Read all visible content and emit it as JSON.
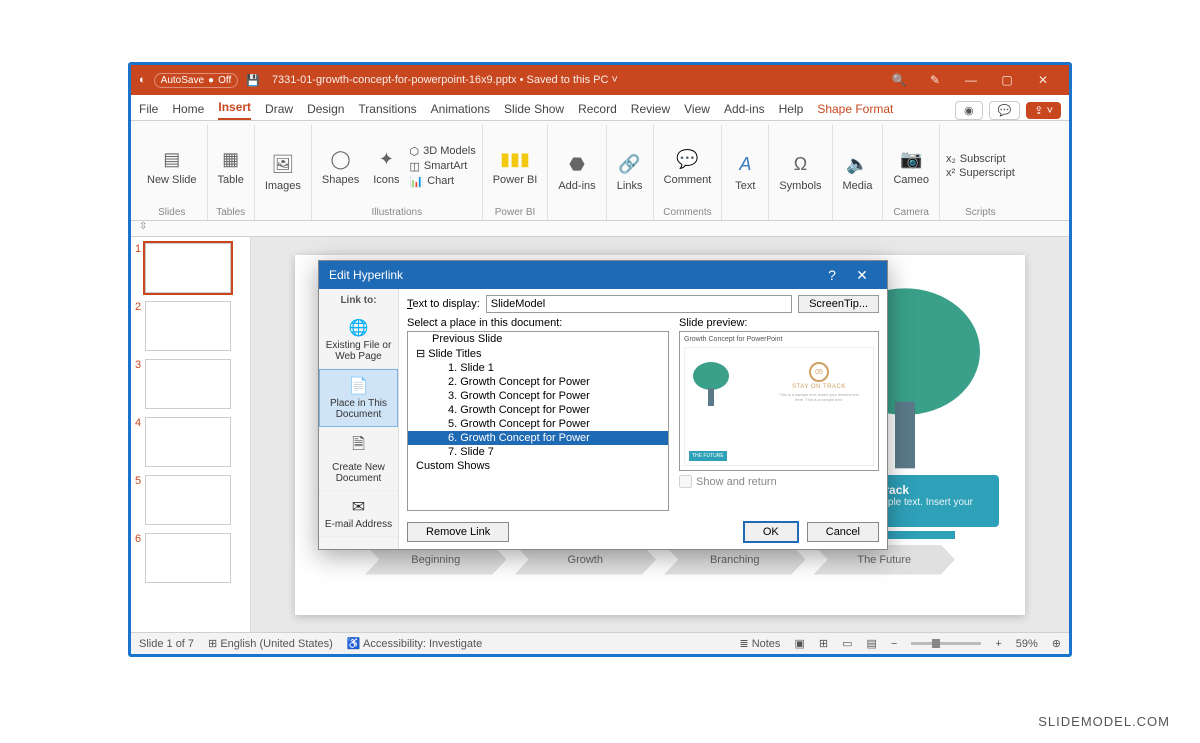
{
  "titlebar": {
    "autosave_label": "AutoSave",
    "autosave_state": "Off",
    "filename": "7331-01-growth-concept-for-powerpoint-16x9.pptx",
    "save_state": "Saved to this PC"
  },
  "tabs": {
    "file": "File",
    "home": "Home",
    "insert": "Insert",
    "draw": "Draw",
    "design": "Design",
    "transitions": "Transitions",
    "animations": "Animations",
    "slideshow": "Slide Show",
    "record": "Record",
    "review": "Review",
    "view": "View",
    "addins": "Add-ins",
    "help": "Help",
    "shape_format": "Shape Format"
  },
  "ribbon": {
    "new_slide": "New Slide",
    "slides_group": "Slides",
    "table": "Table",
    "tables_group": "Tables",
    "images": "Images",
    "shapes": "Shapes",
    "icons": "Icons",
    "models3d": "3D Models",
    "smartart": "SmartArt",
    "chart": "Chart",
    "illustrations_group": "Illustrations",
    "powerbi": "Power BI",
    "powerbi_group": "Power BI",
    "addins": "Add-ins",
    "links": "Links",
    "comment": "Comment",
    "comments_group": "Comments",
    "text": "Text",
    "symbols": "Symbols",
    "media": "Media",
    "cameo": "Cameo",
    "camera_group": "Camera",
    "subscript": "Subscript",
    "superscript": "Superscript",
    "scripts_group": "Scripts"
  },
  "thumbnails": [
    "1",
    "2",
    "3",
    "4",
    "5",
    "6"
  ],
  "slide": {
    "steps": [
      "Beginning",
      "Growth",
      "Branching",
      "The Future"
    ],
    "callout_title": "Stay On Track",
    "callout_body": "This is a sample text. Insert your desired text"
  },
  "dialog": {
    "title": "Edit Hyperlink",
    "link_to": "Link to:",
    "text_to_display_label": "Text to display:",
    "text_to_display_value": "SlideModel",
    "screentip": "ScreenTip...",
    "sidebar": {
      "existing": "Existing File or Web Page",
      "place": "Place in This Document",
      "create_new": "Create New Document",
      "email": "E-mail Address"
    },
    "select_label": "Select a place in this document:",
    "tree": {
      "prev": "Previous Slide",
      "titles": "Slide Titles",
      "s1": "1. Slide 1",
      "s2": "2. Growth Concept for Power",
      "s3": "3. Growth Concept for Power",
      "s4": "4. Growth Concept for Power",
      "s5": "5. Growth Concept for Power",
      "s6": "6. Growth Concept for Power",
      "s7": "7. Slide 7",
      "custom": "Custom Shows"
    },
    "preview_label": "Slide preview:",
    "preview_title": "Growth Concept for PowerPoint",
    "preview_badge_num": "05",
    "preview_badge_text": "STAY ON TRACK",
    "preview_future": "THE FUTURE",
    "show_return": "Show and return",
    "remove_link": "Remove Link",
    "ok": "OK",
    "cancel": "Cancel"
  },
  "statusbar": {
    "slide": "Slide 1 of 7",
    "lang": "English (United States)",
    "accessibility": "Accessibility: Investigate",
    "notes": "Notes",
    "zoom": "59%"
  },
  "watermark": "SLIDEMODEL.COM"
}
